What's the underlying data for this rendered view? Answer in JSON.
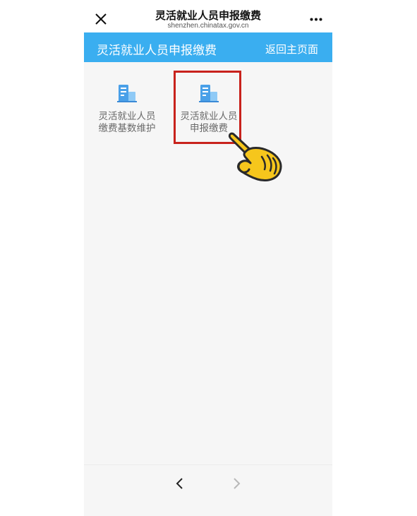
{
  "browser": {
    "title": "灵活就业人员申报缴费",
    "url": "shenzhen.chinatax.gov.cn",
    "close_icon": "close-icon",
    "more_icon": "more-icon"
  },
  "header": {
    "title": "灵活就业人员申报缴费",
    "home_link": "返回主页面",
    "color": "#3aaef0"
  },
  "menu": {
    "items": [
      {
        "label": "灵活就业人员\n缴费基数维护",
        "icon": "document-building-icon",
        "highlighted": false
      },
      {
        "label": "灵活就业人员\n申报缴费",
        "icon": "document-building-icon",
        "highlighted": true
      }
    ]
  },
  "overlay": {
    "highlight_color": "#c8221c",
    "pointer_icon": "pointing-hand-icon"
  },
  "nav": {
    "back_icon": "chevron-left-icon",
    "forward_icon": "chevron-right-icon"
  }
}
